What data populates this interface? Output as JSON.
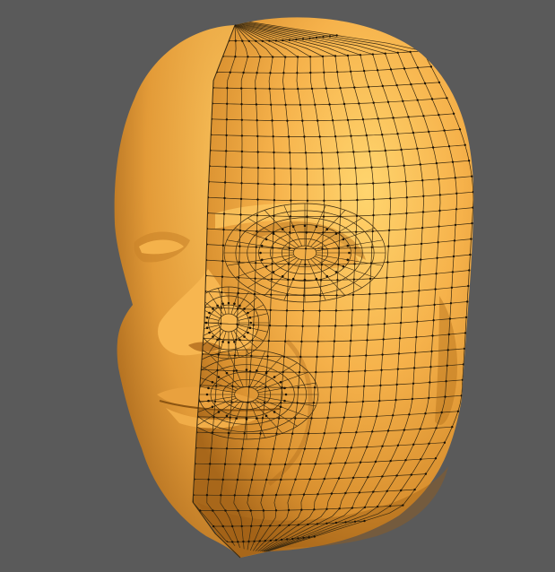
{
  "viewport": {
    "background": "#5a5a5a",
    "model": {
      "shade_light": "#ffd36a",
      "shade_mid": "#f0a63e",
      "shade_dark": "#b9751d",
      "wire_color": "#3a2a10",
      "vertex_color": "#1a1206"
    }
  }
}
